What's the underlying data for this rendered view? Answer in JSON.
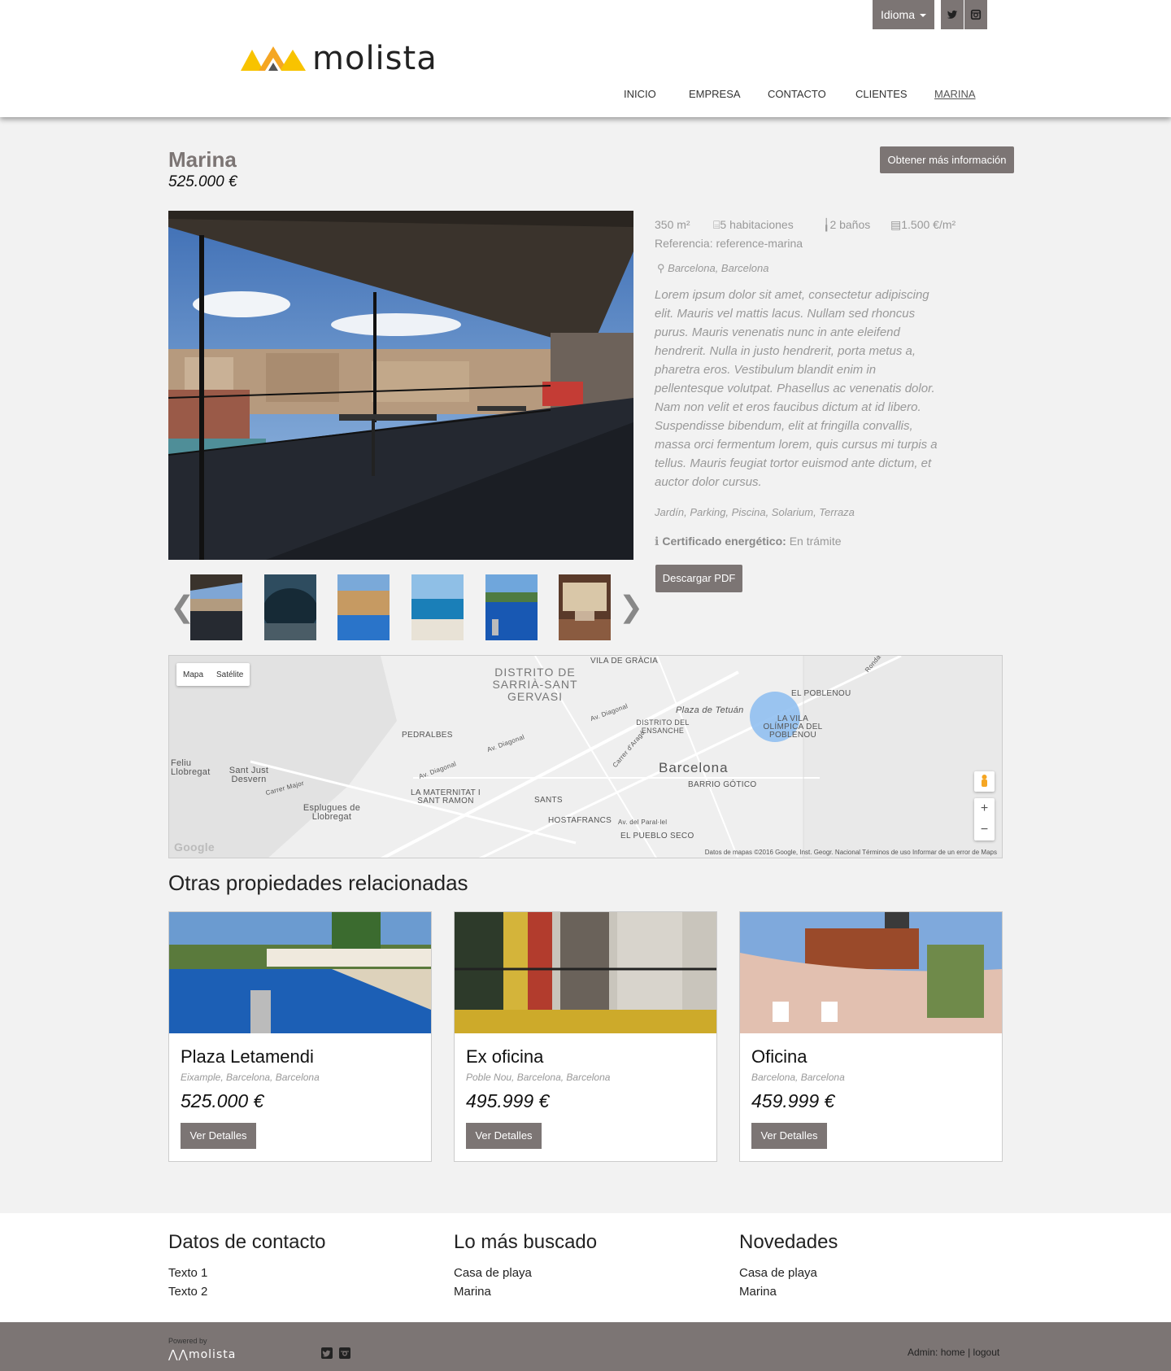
{
  "header": {
    "language_label": "Idioma",
    "logo_text": "molista",
    "nav": [
      "INICIO",
      "EMPRESA",
      "CONTACTO",
      "CLIENTES",
      "MARINA"
    ],
    "social": [
      "twitter-icon",
      "instagram-icon"
    ]
  },
  "property": {
    "title": "Marina",
    "price": "525.000 €",
    "info_button": "Obtener más información",
    "area": "350 m²",
    "rooms": "5 habitaciones",
    "baths": "2 baños",
    "price_per_m2": "1.500 €/m²",
    "reference": "Referencia: reference-marina",
    "location": "Barcelona, Barcelona",
    "description": "Lorem ipsum dolor sit amet, consectetur adipiscing elit. Mauris vel mattis lacus. Nullam sed rhoncus purus. Mauris venenatis nunc in ante eleifend hendrerit. Nulla in justo hendrerit, porta metus a, pharetra eros. Vestibulum blandit enim in pellentesque volutpat. Phasellus ac venenatis dolor. Nam non velit et eros faucibus dictum at id libero. Suspendisse bibendum, elit at fringilla convallis, massa orci fermentum lorem, quis cursus mi turpis a tellus. Mauris feugiat tortor euismod ante dictum, et auctor dolor cursus.",
    "amenities": "Jardín, Parking, Piscina, Solarium, Terraza",
    "cert_label": "Certificado energético:",
    "cert_value": "En trámite",
    "pdf_button": "Descargar PDF"
  },
  "map": {
    "type_map": "Mapa",
    "type_satellite": "Satélite",
    "labels": {
      "sarria": "DISTRITO DE SARRIÀ-SANT GERVASI",
      "gracia": "VILA DE GRÀCIA",
      "poblenou": "EL POBLENOU",
      "tetuan": "Plaza de Tetuán",
      "vila": "LA VILA OLÍMPICA DEL POBLENOU",
      "pedralbes": "PEDRALBES",
      "eixample": "DISTRITO DEL ENSANCHE",
      "barcelona": "Barcelona",
      "gotic": "BARRIO GÓTICO",
      "feliu": "Feliu Llobregat",
      "santjust": "Sant Just Desvern",
      "maternitat": "LA MATERNITAT I SANT RAMON",
      "sants": "SANTS",
      "esplugues": "Esplugues de Llobregat",
      "hostafrancs": "HOSTAFRANCS",
      "pueblo": "EL PUEBLO SECO",
      "diag1": "Av. Diagonal",
      "diag2": "Av. Diagonal",
      "diag3": "Av. Diagonal",
      "carrer": "Carrer Major",
      "arago": "Carrer d'Aragó",
      "parallel": "Av. del Paral·lel",
      "ronda": "Ronda"
    },
    "google": "Google",
    "footer": "Datos de mapas ©2016 Google, Inst. Geogr. Nacional    Términos de uso    Informar de un error de Maps",
    "zoom_in": "+",
    "zoom_out": "−"
  },
  "related": {
    "title": "Otras propiedades relacionadas",
    "items": [
      {
        "name": "Plaza Letamendi",
        "location": "Eixample, Barcelona, Barcelona",
        "price": "525.000 €",
        "button": "Ver Detalles"
      },
      {
        "name": "Ex oficina",
        "location": "Poble Nou, Barcelona, Barcelona",
        "price": "495.999 €",
        "button": "Ver Detalles"
      },
      {
        "name": "Oficina",
        "location": "Barcelona, Barcelona",
        "price": "459.999 €",
        "button": "Ver Detalles"
      }
    ]
  },
  "footer": {
    "contact_title": "Datos de contacto",
    "contact_items": [
      "Texto 1",
      "Texto 2"
    ],
    "popular_title": "Lo más buscado",
    "popular_items": [
      "Casa de playa",
      "Marina"
    ],
    "news_title": "Novedades",
    "news_items": [
      "Casa de playa",
      "Marina"
    ],
    "powered_by": "Powered by",
    "logo_text": "molista",
    "admin_label": "Admin:",
    "home_link": "home",
    "logout_link": "logout"
  },
  "colors": {
    "accent": "#7c7574",
    "logo_orange": "#f5a623",
    "logo_yellow": "#f8c300"
  }
}
